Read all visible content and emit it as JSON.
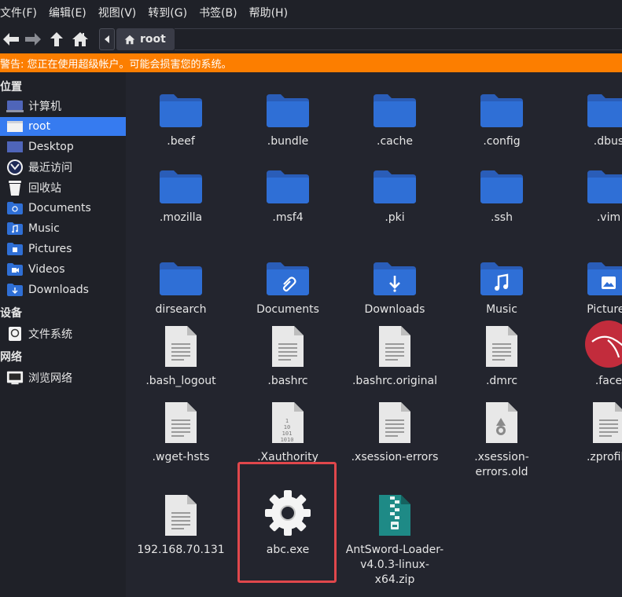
{
  "menu": [
    "文件(F)",
    "编辑(E)",
    "视图(V)",
    "转到(G)",
    "书签(B)",
    "帮助(H)"
  ],
  "location": {
    "crumb": "root"
  },
  "warning": "警告: 您正在使用超级帐户。可能会损害您的系统。",
  "sidebar": {
    "places_title": "位置",
    "devices_title": "设备",
    "network_title": "网络",
    "places": [
      {
        "label": "计算机",
        "icon": "computer-icon"
      },
      {
        "label": "root",
        "icon": "home-folder-icon",
        "selected": true
      },
      {
        "label": "Desktop",
        "icon": "desktop-icon"
      },
      {
        "label": "最近访问",
        "icon": "recent-icon"
      },
      {
        "label": "回收站",
        "icon": "trash-icon"
      },
      {
        "label": "Documents",
        "icon": "documents-folder-icon"
      },
      {
        "label": "Music",
        "icon": "music-folder-icon"
      },
      {
        "label": "Pictures",
        "icon": "pictures-folder-icon"
      },
      {
        "label": "Videos",
        "icon": "videos-folder-icon"
      },
      {
        "label": "Downloads",
        "icon": "downloads-folder-icon"
      }
    ],
    "devices": [
      {
        "label": "文件系统",
        "icon": "filesystem-icon"
      }
    ],
    "network": [
      {
        "label": "浏览网络",
        "icon": "network-icon"
      }
    ]
  },
  "files": [
    [
      ".beef",
      ".bundle",
      ".cache",
      ".config",
      ".dbus"
    ],
    [
      ".mozilla",
      ".msf4",
      ".pki",
      ".ssh",
      ".vim"
    ],
    [
      "dirsearch",
      "Documents",
      "Downloads",
      "Music",
      "Pictures"
    ],
    [
      ".bash_logout",
      ".bashrc",
      ".bashrc.original",
      ".dmrc",
      ".face"
    ],
    [
      ".wget-hsts",
      ".Xauthority",
      ".xsession-errors",
      ".xsession-\nerrors.old",
      ".zprofile"
    ],
    [
      "192.168.70.131",
      "abc.exe",
      "AntSword-Loader-\nv4.0.3-linux-\nx64.zip"
    ]
  ],
  "file_icons": [
    [
      "folder-icon",
      "folder-icon",
      "folder-icon",
      "folder-icon",
      "folder-icon"
    ],
    [
      "folder-icon",
      "folder-icon",
      "folder-icon",
      "folder-icon",
      "folder-icon"
    ],
    [
      "folder-icon",
      "documents-folder-icon",
      "downloads-folder-icon",
      "music-folder-icon",
      "pictures-folder-icon"
    ],
    [
      "text-file-icon",
      "text-file-icon",
      "text-file-icon",
      "text-file-icon",
      "kali-logo-icon"
    ],
    [
      "text-file-icon",
      "binary-file-icon",
      "text-file-icon",
      "recycle-file-icon",
      "text-file-icon"
    ],
    [
      "text-file-icon",
      "gear-executable-icon",
      "zip-archive-icon"
    ]
  ],
  "binary_lines": [
    "1",
    "10",
    "101",
    "1010"
  ],
  "colors": {
    "folder": "#2f6fd6",
    "accent": "#367bf0",
    "warning": "#fc7e00",
    "highlight": "#e0474c"
  }
}
